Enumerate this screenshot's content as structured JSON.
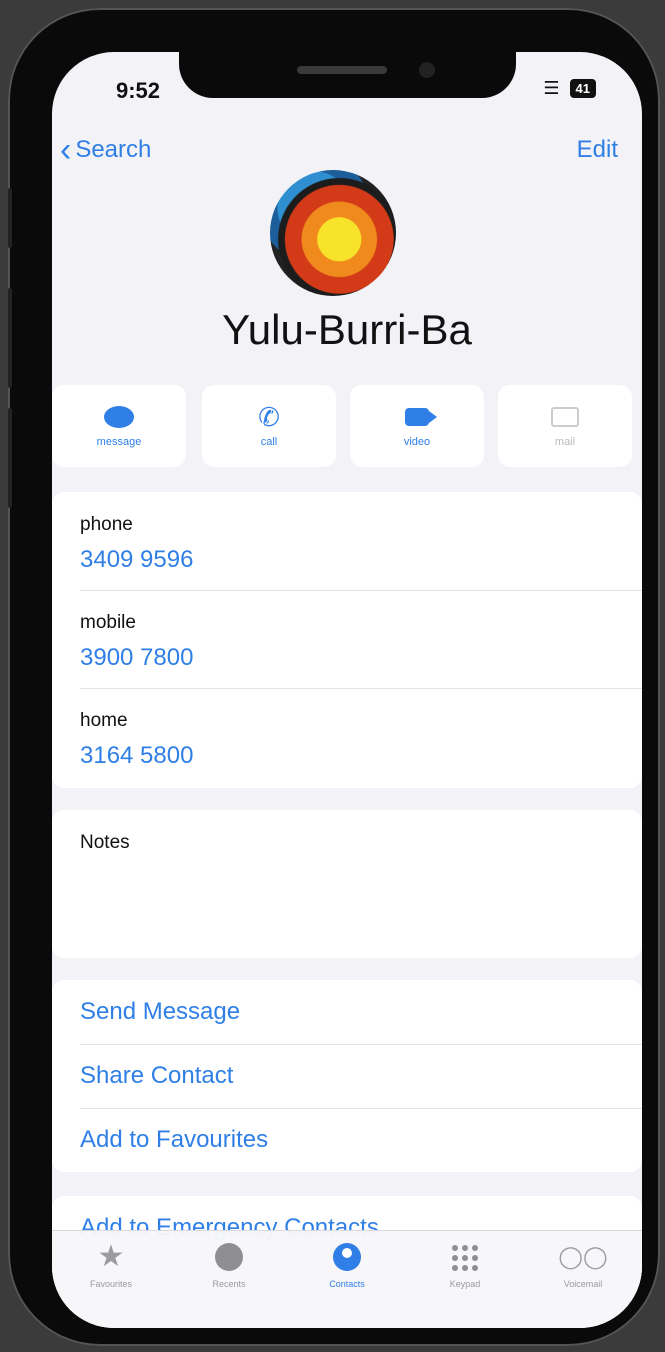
{
  "status": {
    "time": "9:52",
    "battery": "41"
  },
  "nav": {
    "back_label": "Search",
    "edit_label": "Edit"
  },
  "contact": {
    "name": "Yulu-Burri-Ba"
  },
  "actions": [
    {
      "label": "message",
      "icon": "message-icon"
    },
    {
      "label": "call",
      "icon": "phone-icon"
    },
    {
      "label": "video",
      "icon": "video-icon"
    },
    {
      "label": "mail",
      "icon": "mail-icon"
    }
  ],
  "phones": [
    {
      "type": "phone",
      "number": "3409 9596"
    },
    {
      "type": "mobile",
      "number": "3900 7800"
    },
    {
      "type": "home",
      "number": "3164 5800"
    }
  ],
  "notes": {
    "title": "Notes"
  },
  "links": {
    "send_message": "Send Message",
    "share_contact": "Share Contact",
    "add_favourites": "Add to Favourites",
    "add_emergency": "Add to Emergency Contacts"
  },
  "tabs": [
    {
      "label": "Favourites",
      "icon": "star-icon"
    },
    {
      "label": "Recents",
      "icon": "clock-icon"
    },
    {
      "label": "Contacts",
      "icon": "person-icon",
      "active": true
    },
    {
      "label": "Keypad",
      "icon": "keypad-icon"
    },
    {
      "label": "Voicemail",
      "icon": "voicemail-icon"
    }
  ],
  "colors": {
    "accent": "#2f7fe6",
    "background": "#f2f2f7"
  }
}
